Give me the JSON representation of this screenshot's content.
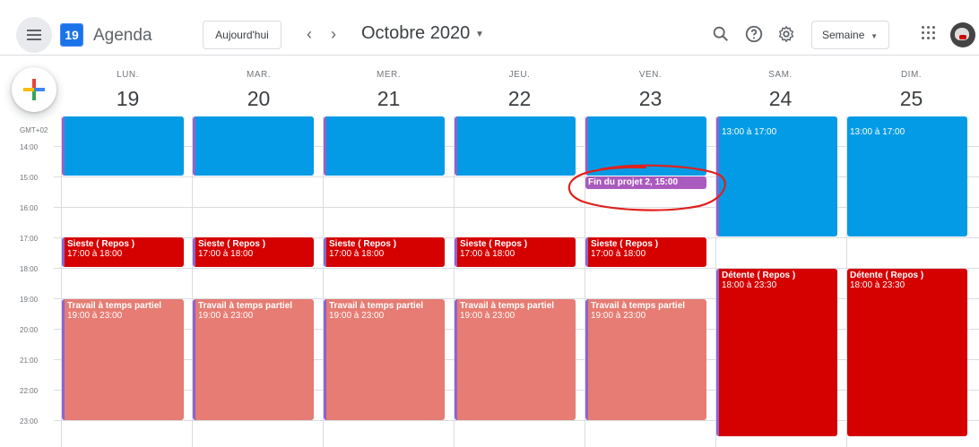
{
  "header": {
    "app_title": "Agenda",
    "logo_day": "19",
    "today_label": "Aujourd'hui",
    "prev_label": "‹",
    "next_label": "›",
    "month_label": "Octobre 2020",
    "view_label": "Semaine",
    "icons": [
      "menu-icon",
      "search-icon",
      "help-icon",
      "settings-icon",
      "apps-icon",
      "avatar"
    ]
  },
  "fab": {
    "icon": "plus-icon"
  },
  "timezone": "GMT+02",
  "days": [
    {
      "name": "LUN.",
      "num": "19"
    },
    {
      "name": "MAR.",
      "num": "20"
    },
    {
      "name": "MER.",
      "num": "21"
    },
    {
      "name": "JEU.",
      "num": "22"
    },
    {
      "name": "VEN.",
      "num": "23"
    },
    {
      "name": "SAM.",
      "num": "24"
    },
    {
      "name": "DIM.",
      "num": "25"
    }
  ],
  "hours": [
    "14:00",
    "15:00",
    "16:00",
    "17:00",
    "18:00",
    "19:00",
    "20:00",
    "21:00",
    "22:00",
    "23:00"
  ],
  "events": {
    "weekday_block": {
      "title": "",
      "time": ""
    },
    "weekend_block": {
      "title": "",
      "time": "13:00 à 17:00"
    },
    "project": {
      "title": "Fin du projet 2, 15:00"
    },
    "sieste": {
      "title": "Sieste ( Repos )",
      "time": "17:00 à 18:00"
    },
    "travail": {
      "title": "Travail à temps partiel",
      "time": "19:00 à 23:00"
    },
    "detente": {
      "title": "Détente ( Repos )",
      "time": "18:00 à 23:30"
    }
  },
  "colors": {
    "blue": "#039be5",
    "red": "#d50000",
    "salmon": "#e67c73",
    "purple": "#8e24aa",
    "annotation_red": "#e0201c"
  }
}
